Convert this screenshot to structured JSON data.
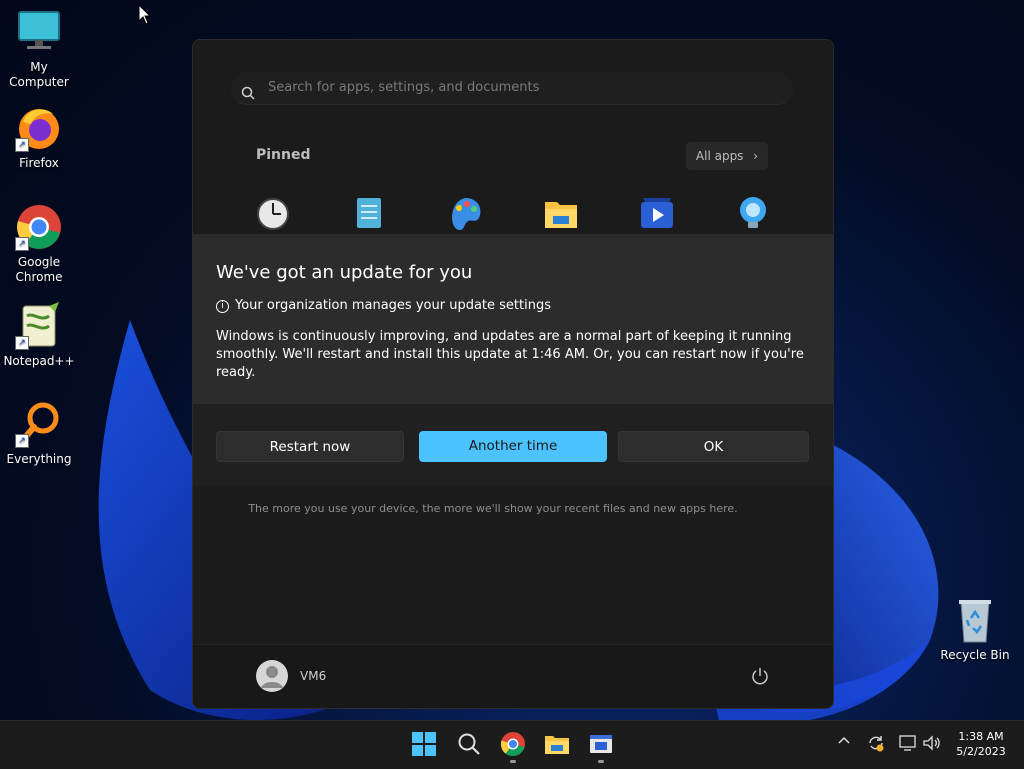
{
  "desktop": {
    "icons": [
      {
        "label": "My Computer"
      },
      {
        "label": "Firefox"
      },
      {
        "label": "Google Chrome"
      },
      {
        "label": "Notepad++"
      },
      {
        "label": "Everything"
      },
      {
        "label": "Recycle Bin"
      }
    ]
  },
  "start_menu": {
    "search_placeholder": "Search for apps, settings, and documents",
    "pinned_title": "Pinned",
    "all_apps_label": "All apps",
    "pinned_apps": [
      {
        "label": "Clock",
        "icon": "clock-icon"
      },
      {
        "label": "Notepad",
        "icon": "notepad-icon"
      },
      {
        "label": "Paint",
        "icon": "paint-icon"
      },
      {
        "label": "File Explorer",
        "icon": "folder-icon"
      },
      {
        "label": "Movies & TV",
        "icon": "movies-icon"
      },
      {
        "label": "Tips",
        "icon": "tips-icon"
      }
    ],
    "recent_message": "The more you use your device, the more we'll show your recent files and new apps here.",
    "user_name": "VM6"
  },
  "update_dialog": {
    "title": "We've got an update for you",
    "org_notice": "Your organization manages your update settings",
    "body": "Windows is continuously improving, and updates are a normal part of keeping it running smoothly. We'll restart and install this update at 1:46 AM. Or, you can restart now if you're ready.",
    "buttons": {
      "restart": "Restart now",
      "later": "Another time",
      "ok": "OK"
    }
  },
  "taskbar": {
    "time": "1:38 AM",
    "date": "5/2/2023"
  },
  "colors": {
    "accent": "#4cc2ff",
    "dialog_bg": "#2c2c2c",
    "start_bg": "#1c1c1c"
  }
}
